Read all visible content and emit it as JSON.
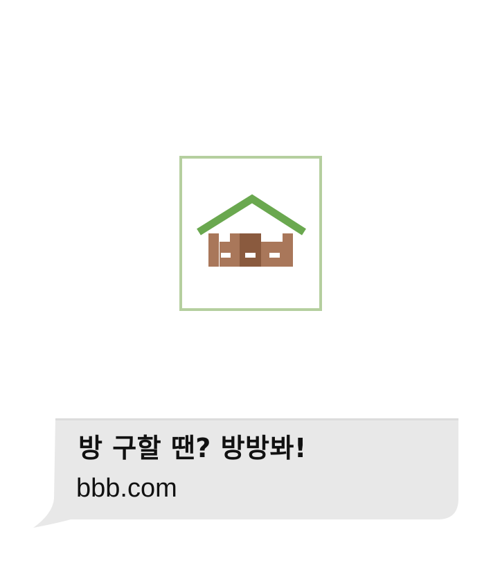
{
  "logo": {
    "icon": "house-with-fence-icon",
    "colors": {
      "roof": "#6aa84f",
      "fence": "#a9775a",
      "fence_dark": "#8a5a3e",
      "frame": "#b5cf9f"
    }
  },
  "message": {
    "line1": "방 구할 땐? 방방봐!",
    "line2": "bbb.com",
    "bubble_color": "#e8e8e8"
  }
}
